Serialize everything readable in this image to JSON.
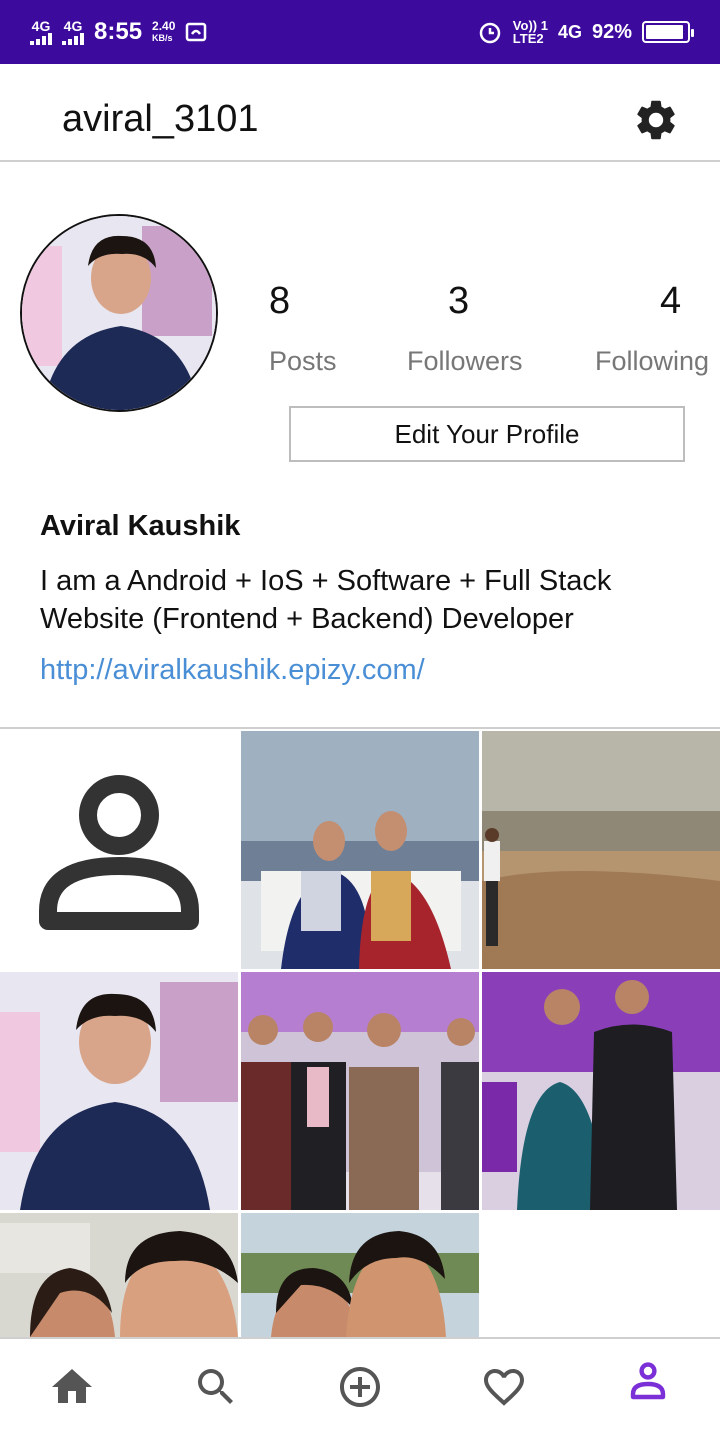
{
  "status_bar": {
    "network1": "4G",
    "network2": "4G",
    "time": "8:55",
    "speed_value": "2.40",
    "speed_unit": "KB/s",
    "volte": "Vo)) 1",
    "lte": "LTE2",
    "network3": "4G",
    "battery_percent": "92%",
    "battery_level": 0.92
  },
  "header": {
    "username": "aviral_3101",
    "settings_icon": "gear-icon"
  },
  "profile": {
    "stats": [
      {
        "value": "8",
        "label": "Posts"
      },
      {
        "value": "3",
        "label": "Followers"
      },
      {
        "value": "4",
        "label": "Following"
      }
    ],
    "edit_button": "Edit Your Profile",
    "full_name": "Aviral Kaushik",
    "bio": "I am a Android + IoS + Software + Full Stack Website (Frontend + Backend) Developer",
    "website": "http://aviralkaushik.epizy.com/"
  },
  "grid": {
    "posts": [
      {
        "kind": "placeholder",
        "icon": "person-icon"
      },
      {
        "kind": "photo",
        "subject": "two men seated"
      },
      {
        "kind": "photo",
        "subject": "landscape"
      },
      {
        "kind": "photo",
        "subject": "portrait"
      },
      {
        "kind": "photo",
        "subject": "group of men"
      },
      {
        "kind": "photo",
        "subject": "couple"
      },
      {
        "kind": "photo",
        "subject": "selfie"
      },
      {
        "kind": "photo",
        "subject": "selfie outdoors"
      }
    ]
  },
  "bottom_nav": {
    "items": [
      "home-icon",
      "search-icon",
      "add-icon",
      "heart-icon",
      "profile-icon"
    ],
    "active_color": "#7b2fd6",
    "inactive_color": "#555555"
  },
  "colors": {
    "status_bar": "#3d0a9e",
    "link": "#4a8fd6",
    "divider": "#cfcfcf"
  }
}
